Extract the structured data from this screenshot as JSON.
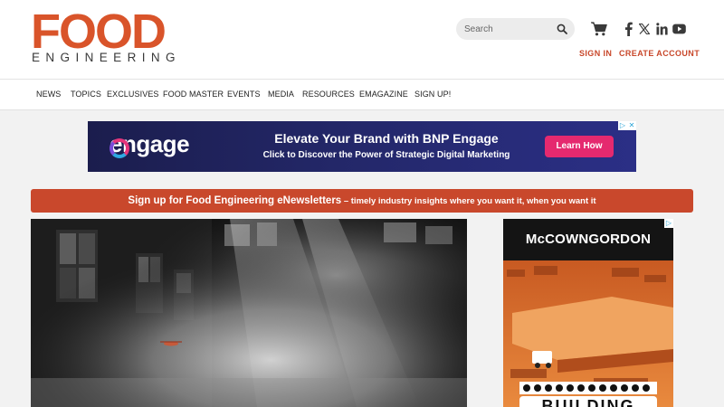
{
  "brand": {
    "logo_line1": "FOOD",
    "logo_line2": "ENGINEERING",
    "accent_color": "#d9542a"
  },
  "header": {
    "search_placeholder": "Search",
    "icons": [
      "search-icon",
      "cart-icon",
      "facebook-icon",
      "x-icon",
      "linkedin-icon",
      "youtube-icon"
    ],
    "sign_in": "SIGN IN",
    "create_account": "CREATE ACCOUNT"
  },
  "nav": {
    "items": [
      "NEWS",
      "TOPICS",
      "EXCLUSIVES",
      "FOOD MASTER",
      "EVENTS",
      "MEDIA",
      "RESOURCES",
      "EMAGAZINE",
      "SIGN UP!"
    ]
  },
  "banner_ad": {
    "logo_text": "engage",
    "headline": "Elevate Your Brand with BNP Engage",
    "subline": "Click to Discover the Power of Strategic Digital Marketing",
    "cta": "Learn How",
    "cta_color": "#e5296f"
  },
  "newsletter": {
    "lead": "Sign up for Food Engineering eNewsletters",
    "rest": " – timely industry insights where you want it, when you want it"
  },
  "side_ad": {
    "brand": "McCOWNGORDON",
    "words": "BUILDING"
  }
}
